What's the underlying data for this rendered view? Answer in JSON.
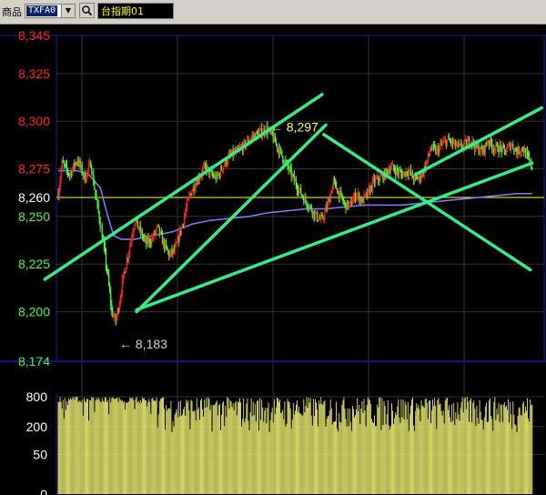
{
  "toolbar": {
    "product_label": "商品",
    "symbol_value": "TXFA0",
    "dropdown_arrow": "▼",
    "search_icon": "search-icon",
    "title": "台指期01"
  },
  "colors": {
    "background": "#000000",
    "grid": "#1a1aa8",
    "axis_red": "#ff2020",
    "axis_green": "#40ff40",
    "axis_white": "#ffffff",
    "candle_up": "#ff2020",
    "candle_down": "#40ff40",
    "ma_line": "#8080ff",
    "ref_line": "#ffff40",
    "trendline": "#33ee88",
    "volume": "#e8e870"
  },
  "chart_data": [
    {
      "type": "candlestick",
      "title": "",
      "ylim": [
        8174,
        8345
      ],
      "y_ticks": [
        {
          "value": 8345,
          "label": "8,345",
          "color": "red"
        },
        {
          "value": 8325,
          "label": "8,325",
          "color": "red"
        },
        {
          "value": 8300,
          "label": "8,300",
          "color": "red"
        },
        {
          "value": 8275,
          "label": "8,275",
          "color": "red"
        },
        {
          "value": 8260,
          "label": "8,260",
          "color": "white"
        },
        {
          "value": 8250,
          "label": "8,250",
          "color": "green"
        },
        {
          "value": 8225,
          "label": "8,225",
          "color": "green"
        },
        {
          "value": 8200,
          "label": "8,200",
          "color": "green"
        },
        {
          "value": 8174,
          "label": "8,174",
          "color": "green"
        }
      ],
      "reference_price": 8260,
      "annotations": [
        {
          "label": "8,297",
          "value": 8297,
          "kind": "high"
        },
        {
          "label": "8,183",
          "value": 8183,
          "kind": "low"
        }
      ],
      "price_path": [
        [
          0,
          8262
        ],
        [
          4,
          8278
        ],
        [
          12,
          8272
        ],
        [
          20,
          8280
        ],
        [
          28,
          8270
        ],
        [
          34,
          8278
        ],
        [
          40,
          8258
        ],
        [
          46,
          8240
        ],
        [
          52,
          8218
        ],
        [
          56,
          8200
        ],
        [
          60,
          8195
        ],
        [
          64,
          8205
        ],
        [
          68,
          8218
        ],
        [
          74,
          8232
        ],
        [
          80,
          8248
        ],
        [
          86,
          8242
        ],
        [
          92,
          8236
        ],
        [
          98,
          8238
        ],
        [
          104,
          8244
        ],
        [
          110,
          8236
        ],
        [
          116,
          8230
        ],
        [
          122,
          8232
        ],
        [
          130,
          8246
        ],
        [
          138,
          8262
        ],
        [
          146,
          8270
        ],
        [
          154,
          8276
        ],
        [
          160,
          8272
        ],
        [
          166,
          8270
        ],
        [
          172,
          8276
        ],
        [
          180,
          8282
        ],
        [
          188,
          8284
        ],
        [
          196,
          8288
        ],
        [
          204,
          8292
        ],
        [
          212,
          8294
        ],
        [
          218,
          8296
        ],
        [
          224,
          8292
        ],
        [
          230,
          8286
        ],
        [
          238,
          8278
        ],
        [
          246,
          8270
        ],
        [
          254,
          8262
        ],
        [
          262,
          8256
        ],
        [
          270,
          8250
        ],
        [
          276,
          8248
        ],
        [
          282,
          8256
        ],
        [
          288,
          8268
        ],
        [
          294,
          8262
        ],
        [
          300,
          8256
        ],
        [
          306,
          8256
        ],
        [
          312,
          8262
        ],
        [
          318,
          8258
        ],
        [
          324,
          8262
        ],
        [
          330,
          8268
        ],
        [
          336,
          8270
        ],
        [
          342,
          8272
        ],
        [
          348,
          8276
        ],
        [
          354,
          8274
        ],
        [
          360,
          8272
        ],
        [
          366,
          8274
        ],
        [
          372,
          8270
        ],
        [
          378,
          8270
        ],
        [
          384,
          8276
        ],
        [
          390,
          8286
        ],
        [
          396,
          8284
        ],
        [
          402,
          8288
        ],
        [
          408,
          8290
        ],
        [
          414,
          8288
        ],
        [
          420,
          8286
        ],
        [
          426,
          8288
        ],
        [
          432,
          8290
        ],
        [
          438,
          8286
        ],
        [
          444,
          8284
        ],
        [
          450,
          8290
        ],
        [
          456,
          8286
        ],
        [
          462,
          8286
        ],
        [
          468,
          8284
        ],
        [
          474,
          8288
        ],
        [
          480,
          8284
        ],
        [
          486,
          8286
        ],
        [
          492,
          8280
        ],
        [
          496,
          8276
        ]
      ],
      "moving_average": [
        [
          0,
          8274
        ],
        [
          20,
          8274
        ],
        [
          32,
          8272
        ],
        [
          44,
          8265
        ],
        [
          52,
          8250
        ],
        [
          58,
          8240
        ],
        [
          66,
          8238
        ],
        [
          80,
          8238
        ],
        [
          100,
          8240
        ],
        [
          120,
          8242
        ],
        [
          140,
          8246
        ],
        [
          160,
          8248
        ],
        [
          180,
          8249
        ],
        [
          200,
          8250
        ],
        [
          220,
          8252
        ],
        [
          240,
          8253
        ],
        [
          260,
          8254
        ],
        [
          280,
          8254
        ],
        [
          300,
          8255
        ],
        [
          320,
          8256
        ],
        [
          340,
          8256
        ],
        [
          360,
          8256
        ],
        [
          380,
          8257
        ],
        [
          400,
          8258
        ],
        [
          420,
          8259
        ],
        [
          440,
          8260
        ],
        [
          460,
          8261
        ],
        [
          480,
          8262
        ],
        [
          496,
          8262
        ]
      ],
      "trendlines": [
        {
          "from": [
            -14,
            8217
          ],
          "to": [
            276,
            8314
          ]
        },
        {
          "from": [
            82,
            8200
          ],
          "to": [
            280,
            8298
          ]
        },
        {
          "from": [
            82,
            8201
          ],
          "to": [
            496,
            8278
          ]
        },
        {
          "from": [
            278,
            8293
          ],
          "to": [
            494,
            8222
          ]
        },
        {
          "from": [
            374,
            8272
          ],
          "to": [
            506,
            8307
          ]
        }
      ]
    },
    {
      "type": "bar",
      "title": "",
      "ylim": [
        0,
        800
      ],
      "y_ticks": [
        {
          "value": 800,
          "label": "800"
        },
        {
          "value": 200,
          "label": "200"
        },
        {
          "value": 50,
          "label": "50"
        },
        {
          "value": 0,
          "label": "0"
        }
      ]
    }
  ]
}
